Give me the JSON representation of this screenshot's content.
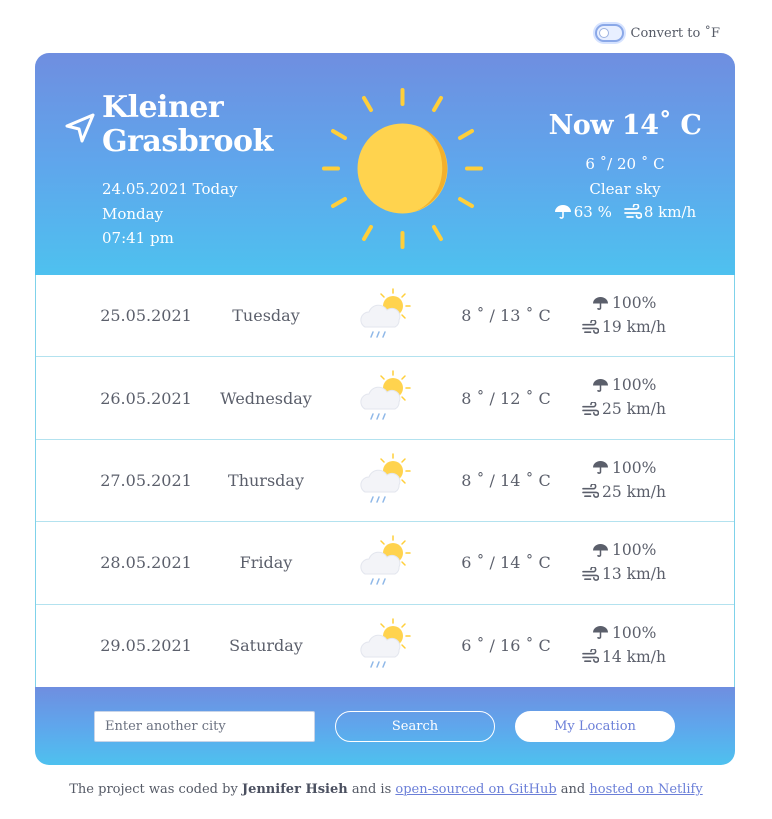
{
  "toggle": {
    "label": "Convert to ˚F",
    "checked": false
  },
  "current": {
    "city_line1": "Kleiner",
    "city_line2": "Grasbrook",
    "date": "24.05.2021 Today",
    "weekday": "Monday",
    "time": "07:41 pm",
    "now_temp": "Now 14˚ C",
    "range": "6 ˚/ 20 ˚ C",
    "description": "Clear sky",
    "precipitation": "63 %",
    "wind": "8 km/h",
    "icon": "sun-icon"
  },
  "forecast": [
    {
      "date": "25.05.2021",
      "day": "Tuesday",
      "temp": "8 ˚ / 13 ˚ C",
      "rain": "100%",
      "wind": "19 km/h",
      "icon": "sun-cloud-rain-icon"
    },
    {
      "date": "26.05.2021",
      "day": "Wednesday",
      "temp": "8 ˚ / 12 ˚ C",
      "rain": "100%",
      "wind": "25 km/h",
      "icon": "sun-cloud-rain-icon"
    },
    {
      "date": "27.05.2021",
      "day": "Thursday",
      "temp": "8 ˚ / 14 ˚ C",
      "rain": "100%",
      "wind": "25 km/h",
      "icon": "sun-cloud-rain-icon"
    },
    {
      "date": "28.05.2021",
      "day": "Friday",
      "temp": "6 ˚ / 14 ˚ C",
      "rain": "100%",
      "wind": "13 km/h",
      "icon": "sun-cloud-rain-icon"
    },
    {
      "date": "29.05.2021",
      "day": "Saturday",
      "temp": "6 ˚ / 16 ˚ C",
      "rain": "100%",
      "wind": "14 km/h",
      "icon": "sun-cloud-rain-icon"
    }
  ],
  "search": {
    "placeholder": "Enter another city",
    "search_label": "Search",
    "location_label": "My Location"
  },
  "footer": {
    "prefix": "The project was coded by",
    "author": "Jennifer Hsieh",
    "middle": "and is",
    "github_link": "open-sourced on GitHub",
    "and": "and",
    "netlify_link": "hosted on Netlify"
  },
  "colors": {
    "gradient_top": "#6f8ee0",
    "gradient_bottom": "#4ec1ef",
    "accent": "#6b7fd8",
    "sun": "#ffd34e",
    "sun_rays": "#ffcf3a"
  }
}
